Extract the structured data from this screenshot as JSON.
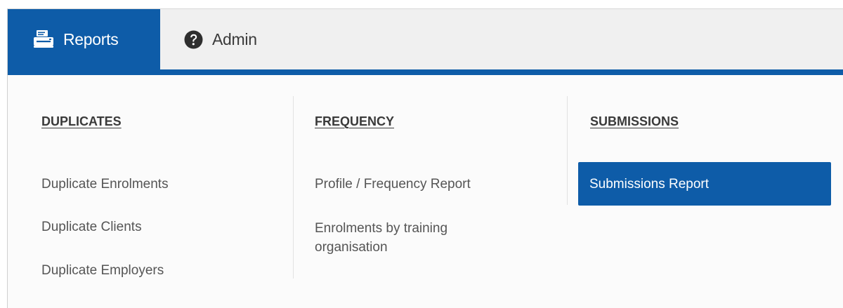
{
  "nav": {
    "tabs": [
      {
        "label": "Reports",
        "icon": "reports-printer-icon",
        "active": true
      },
      {
        "label": "Admin",
        "icon": "question-circle-icon",
        "active": false
      }
    ]
  },
  "colors": {
    "accent": "#0e5ca8",
    "text": "#555555",
    "heading": "#3a3a3a"
  },
  "menu": {
    "columns": [
      {
        "heading": "DUPLICATES",
        "items": [
          "Duplicate Enrolments",
          "Duplicate Clients",
          "Duplicate Employers"
        ]
      },
      {
        "heading": "FREQUENCY",
        "items": [
          "Profile / Frequency Report",
          "Enrolments by training organisation"
        ]
      },
      {
        "heading": "SUBMISSIONS",
        "items": [
          "Submissions Report"
        ]
      }
    ]
  }
}
